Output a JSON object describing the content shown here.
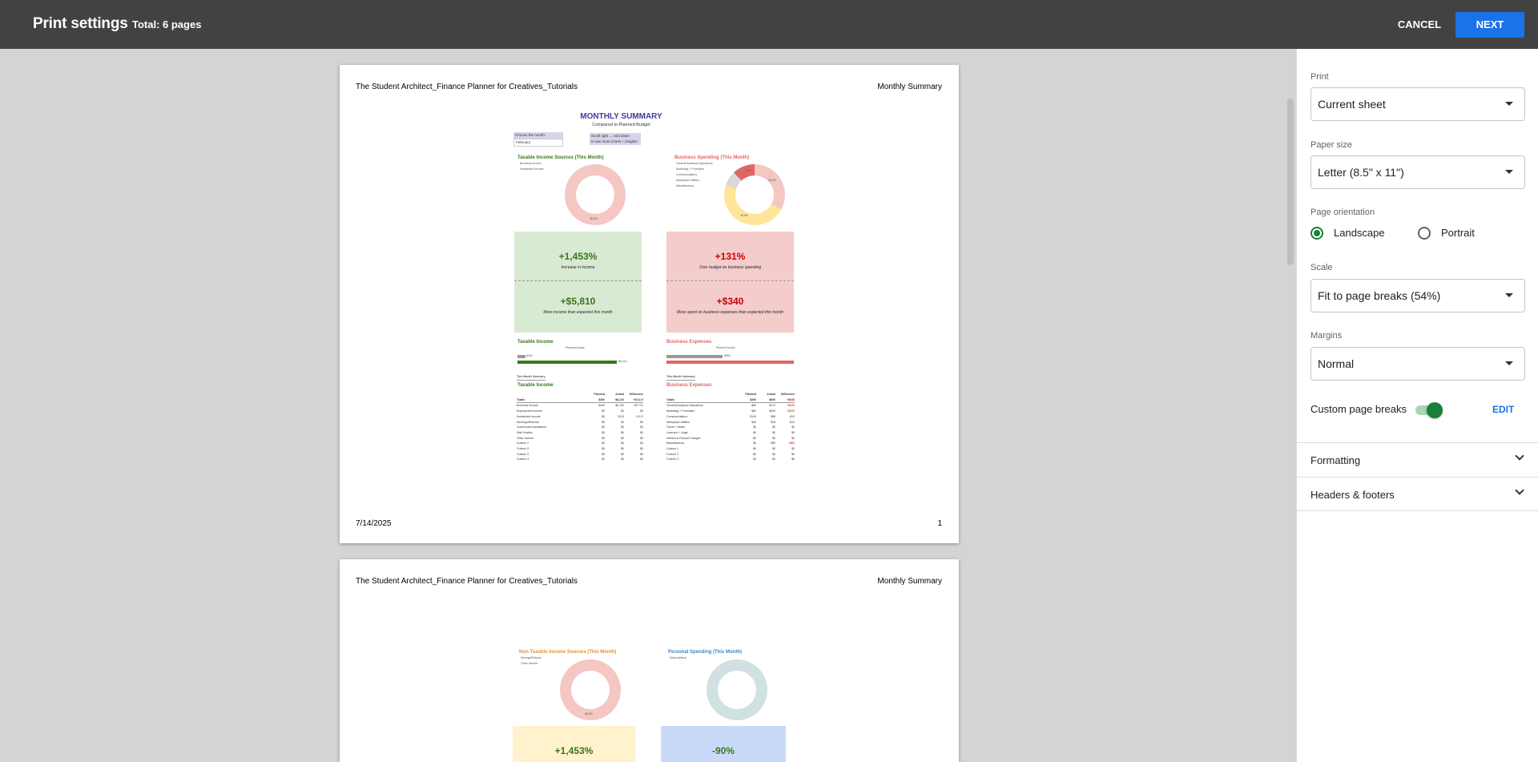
{
  "topbar": {
    "title": "Print settings",
    "total": "Total: 6 pages",
    "cancel_label": "CANCEL",
    "next_label": "NEXT"
  },
  "page1": {
    "header_left": "The Student Architect_Finance Planner for Creatives_Tutorials",
    "header_right": "Monthly Summary",
    "footer_date": "7/14/2025",
    "footer_page": "1",
    "summary_title": "MONTHLY SUMMARY",
    "summary_subtitle": "Compared to Planned Budget",
    "choose_month": "Choose the month:",
    "month": "February",
    "scroll_hint_1": "Scroll right → and down",
    "scroll_hint_2": "to see more charts + insights",
    "taxable_income_sources_title": "Taxable Income Sources (This Month)",
    "taxable_legend_1": "Business Income",
    "taxable_legend_2": "Investment Income",
    "taxable_donut_label": "98.2%",
    "business_spending_title": "Business Spending (This Month)",
    "business_legend": [
      "General Business Operations",
      "Marketing + Promotion",
      "Communications",
      "Workplace Utilities",
      "Miscellaneous"
    ],
    "business_donut_labels": [
      "8.1%",
      "33.3%",
      "46.9%"
    ],
    "income_pct": "+1,453%",
    "income_pct_caption": "Increase in income",
    "income_amt": "+$5,810",
    "income_amt_caption": "More income than expected this month",
    "business_pct": "+131%",
    "business_pct_caption": "Over budget on business spending",
    "business_amt": "+$340",
    "business_amt_caption": "More spent on business expenses than expected this month",
    "taxable_income_label": "Taxable Income",
    "business_expenses_label": "Business Expenses",
    "planned": "Planned",
    "actual": "Actual",
    "bar_left_val_1": "$400",
    "bar_left_val_2": "$6,210",
    "bar_right_val": "$600",
    "this_month_summary": "This Month Summary",
    "table_left_title": "Taxable Income",
    "table_right_title": "Business Expenses",
    "table_cols": [
      "Planned",
      "Actual",
      "Difference"
    ],
    "table_left_rows": [
      [
        "Totals",
        "$400",
        "$6,210",
        "+$5,810"
      ],
      [
        "Business Income",
        "$400",
        "$6,100",
        "+$5,700"
      ],
      [
        "Employment Income",
        "$0",
        "$0",
        "$0"
      ],
      [
        "Investment Income",
        "$0",
        "$110",
        "+$110"
      ],
      [
        "Earnings/Refunds",
        "$0",
        "$0",
        "$0"
      ],
      [
        "Government Assistance",
        "$0",
        "$0",
        "$0"
      ],
      [
        "Side Hustles",
        "$0",
        "$0",
        "$0"
      ],
      [
        "Other Income",
        "$0",
        "$0",
        "$0"
      ],
      [
        "Custom 1",
        "$0",
        "$0",
        "$0"
      ],
      [
        "Custom 2",
        "$0",
        "$0",
        "$0"
      ],
      [
        "Custom 3",
        "$0",
        "$0",
        "$0"
      ],
      [
        "Custom 4",
        "$0",
        "$0",
        "$0"
      ]
    ],
    "table_right_rows": [
      [
        "Totals",
        "$260",
        "$600",
        "+$340"
      ],
      [
        "General Business Operations",
        "$50",
        "$170",
        "+$120"
      ],
      [
        "Marketing + Promotion",
        "$60",
        "$260",
        "+$200"
      ],
      [
        "Communications",
        "$100",
        "$88",
        "-$12"
      ],
      [
        "Workplace Utilities",
        "$40",
        "$28",
        "-$12"
      ],
      [
        "Travel + Meals",
        "$0",
        "$0",
        "$0"
      ],
      [
        "Licenses + Legal",
        "$0",
        "$0",
        "$0"
      ],
      [
        "Interest & Finance Charges",
        "$0",
        "$0",
        "$0"
      ],
      [
        "Miscellaneous",
        "$0",
        "$50",
        "+$50"
      ],
      [
        "Custom 1",
        "$0",
        "$0",
        "$0"
      ],
      [
        "Custom 2",
        "$0",
        "$0",
        "$0"
      ],
      [
        "Custom 3",
        "$0",
        "$0",
        "$0"
      ]
    ]
  },
  "page2": {
    "header_left": "The Student Architect_Finance Planner for Creatives_Tutorials",
    "header_right": "Monthly Summary",
    "nontaxable_title": "Non-Taxable Income Sources (This Month)",
    "nontaxable_legend_1": "Savings/Returns",
    "nontaxable_legend_2": "Other Income",
    "nontaxable_donut_label": "98.2%",
    "personal_title": "Personal Spending (This Month)",
    "personal_legend_1": "Subscriptions",
    "nontaxable_pct": "+1,453%",
    "personal_pct": "-90%"
  },
  "panel": {
    "print_label": "Print",
    "print_value": "Current sheet",
    "paper_label": "Paper size",
    "paper_value": "Letter (8.5\" x 11\")",
    "orientation_label": "Page orientation",
    "landscape_label": "Landscape",
    "portrait_label": "Portrait",
    "orientation_selected": "Landscape",
    "scale_label": "Scale",
    "scale_value": "Fit to page breaks (54%)",
    "margins_label": "Margins",
    "margins_value": "Normal",
    "custom_breaks_label": "Custom page breaks",
    "custom_breaks_on": true,
    "edit_label": "EDIT",
    "formatting_label": "Formatting",
    "headers_label": "Headers & footers"
  },
  "colors": {
    "topbar": "#424242",
    "accent_blue": "#1a73e8",
    "accent_green": "#188038",
    "income_green_bg": "#d9ead3",
    "spending_red_bg": "#f4cccc",
    "income_text": "#38761d",
    "spending_text": "#cc0000"
  }
}
